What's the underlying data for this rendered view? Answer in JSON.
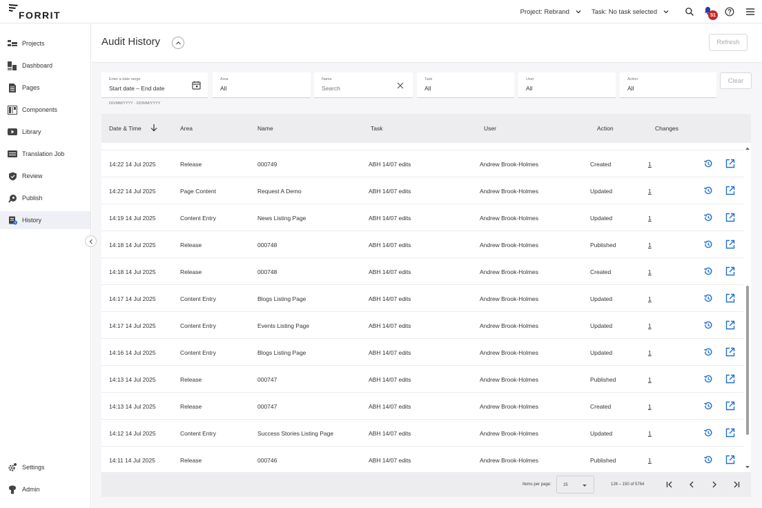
{
  "app": {
    "logo_text": "FORRIT"
  },
  "topbar": {
    "project_selector": "Project: Rebrand",
    "task_selector": "Task: No task selected",
    "notification_count": "51"
  },
  "sidebar": {
    "items": [
      {
        "label": "Projects",
        "icon": "projects-icon"
      },
      {
        "label": "Dashboard",
        "icon": "dashboard-icon"
      },
      {
        "label": "Pages",
        "icon": "pages-icon"
      },
      {
        "label": "Components",
        "icon": "components-icon"
      },
      {
        "label": "Library",
        "icon": "library-icon"
      },
      {
        "label": "Translation Job",
        "icon": "translation-icon"
      },
      {
        "label": "Review",
        "icon": "review-icon"
      },
      {
        "label": "Publish",
        "icon": "publish-icon"
      },
      {
        "label": "History",
        "icon": "history-icon",
        "active": true
      }
    ],
    "bottom_items": [
      {
        "label": "Settings",
        "icon": "settings-icon"
      },
      {
        "label": "Admin",
        "icon": "admin-icon"
      }
    ]
  },
  "header": {
    "title": "Audit History",
    "refresh_label": "Refresh"
  },
  "filters": {
    "date": {
      "label": "Enter a date range",
      "value": "Start date – End date",
      "hint": "DD/MM/YYYY - DD/MM/YYYY"
    },
    "area": {
      "label": "Area",
      "value": "All"
    },
    "name": {
      "label": "Name",
      "placeholder": "Search"
    },
    "task": {
      "label": "Task",
      "value": "All"
    },
    "user": {
      "label": "User",
      "value": "All"
    },
    "action": {
      "label": "Action",
      "value": "All"
    },
    "clear_label": "Clear"
  },
  "table": {
    "columns": [
      "Date & Time",
      "Area",
      "Name",
      "Task",
      "User",
      "Action",
      "Changes"
    ],
    "rows": [
      {
        "datetime": "14:22 14 Jul 2025",
        "area": "Release",
        "name": "000749",
        "task": "ABH 14/07 edits",
        "user": "Andrew Brook-Holmes",
        "action": "Created",
        "changes": "1"
      },
      {
        "datetime": "14:22 14 Jul 2025",
        "area": "Page Content",
        "name": "Request A Demo",
        "task": "ABH 14/07 edits",
        "user": "Andrew Brook-Holmes",
        "action": "Updated",
        "changes": "1"
      },
      {
        "datetime": "14:19 14 Jul 2025",
        "area": "Content Entry",
        "name": "News Listing Page",
        "task": "ABH 14/07 edits",
        "user": "Andrew Brook-Holmes",
        "action": "Updated",
        "changes": "1"
      },
      {
        "datetime": "14:18 14 Jul 2025",
        "area": "Release",
        "name": "000748",
        "task": "ABH 14/07 edits",
        "user": "Andrew Brook-Holmes",
        "action": "Published",
        "changes": "1"
      },
      {
        "datetime": "14:18 14 Jul 2025",
        "area": "Release",
        "name": "000748",
        "task": "ABH 14/07 edits",
        "user": "Andrew Brook-Holmes",
        "action": "Created",
        "changes": "1"
      },
      {
        "datetime": "14:17 14 Jul 2025",
        "area": "Content Entry",
        "name": "Blogs Listing Page",
        "task": "ABH 14/07 edits",
        "user": "Andrew Brook-Holmes",
        "action": "Updated",
        "changes": "1"
      },
      {
        "datetime": "14:17 14 Jul 2025",
        "area": "Content Entry",
        "name": "Events Listing Page",
        "task": "ABH 14/07 edits",
        "user": "Andrew Brook-Holmes",
        "action": "Updated",
        "changes": "1"
      },
      {
        "datetime": "14:16 14 Jul 2025",
        "area": "Content Entry",
        "name": "Blogs Listing Page",
        "task": "ABH 14/07 edits",
        "user": "Andrew Brook-Holmes",
        "action": "Updated",
        "changes": "1"
      },
      {
        "datetime": "14:13 14 Jul 2025",
        "area": "Release",
        "name": "000747",
        "task": "ABH 14/07 edits",
        "user": "Andrew Brook-Holmes",
        "action": "Published",
        "changes": "1"
      },
      {
        "datetime": "14:13 14 Jul 2025",
        "area": "Release",
        "name": "000747",
        "task": "ABH 14/07 edits",
        "user": "Andrew Brook-Holmes",
        "action": "Created",
        "changes": "1"
      },
      {
        "datetime": "14:12 14 Jul 2025",
        "area": "Content Entry",
        "name": "Success Stories Listing Page",
        "task": "ABH 14/07 edits",
        "user": "Andrew Brook-Holmes",
        "action": "Updated",
        "changes": "1"
      },
      {
        "datetime": "14:11 14 Jul 2025",
        "area": "Release",
        "name": "000746",
        "task": "ABH 14/07 edits",
        "user": "Andrew Brook-Holmes",
        "action": "Published",
        "changes": "1"
      }
    ]
  },
  "paginator": {
    "items_per_page_label": "Items per page:",
    "items_per_page": "25",
    "range_label": "126 – 150 of 5764"
  },
  "colors": {
    "accent": "#1e6fd0",
    "badge": "#c62828"
  }
}
